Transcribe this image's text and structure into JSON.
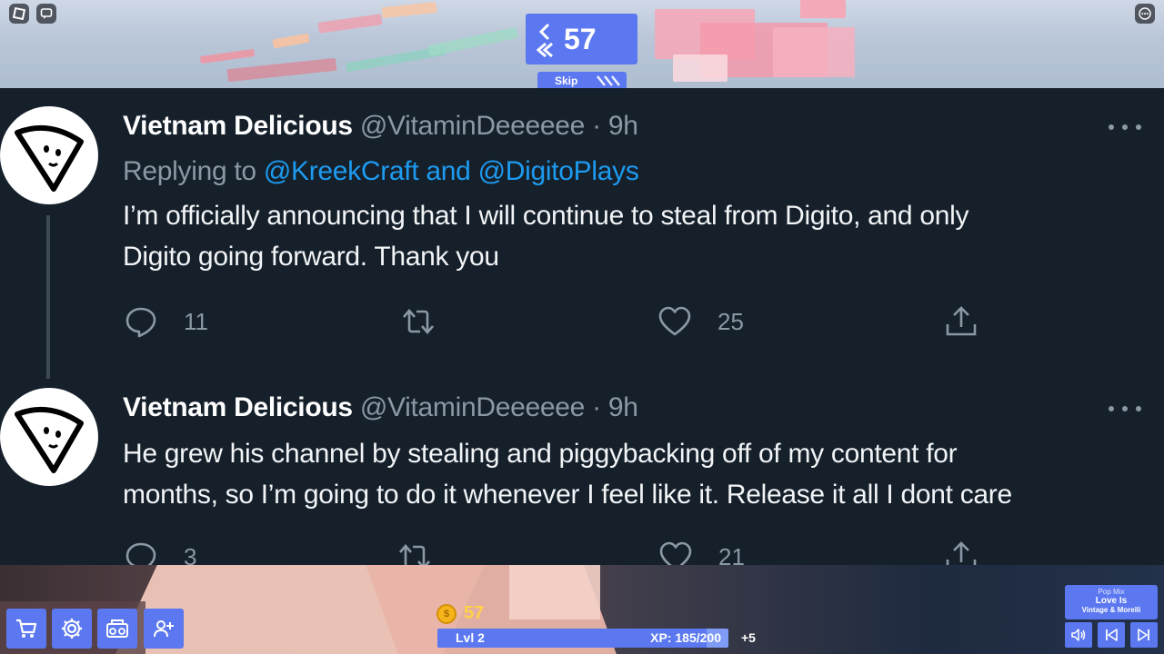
{
  "hud_top": {
    "counter_value": "57",
    "skip_label": "Skip",
    "icons": [
      "roblox-logo-icon",
      "chat-icon",
      "more-options-icon",
      "rewind-icon",
      "skip-forward-icon"
    ]
  },
  "tweets": [
    {
      "name": "Vietnam Delicious",
      "handle": "@VitaminDeeeeee",
      "time": "9h",
      "separator": "·",
      "replying_label": "Replying to",
      "replying_mentions": "@KreekCraft and @DigitoPlays",
      "text_line1": "I’m officially announcing that I will continue to steal from Digito, and only",
      "text_line2": "Digito going forward. Thank you",
      "replies": "11",
      "likes": "25"
    },
    {
      "name": "Vietnam Delicious",
      "handle": "@VitaminDeeeeee",
      "time": "9h",
      "separator": "·",
      "text_line1": "He grew his channel by stealing and piggybacking off of my content for",
      "text_line2": "months, so I’m going to do it whenever I feel like it. Release it all I dont care",
      "replies": "3",
      "likes": "21"
    }
  ],
  "hud_bottom": {
    "buttons": [
      "shop",
      "settings",
      "boombox",
      "invite-friends"
    ],
    "coins": "57",
    "coin_symbol": "$",
    "level_label": "Lvl 2",
    "xp_label": "XP: 185/200",
    "xp_progress": 0.925,
    "xp_gain": "+5",
    "music": {
      "mix": "Pop Mix",
      "song": "Love Is",
      "artist": "Vintage & Morelli"
    }
  },
  "colors": {
    "accent": "#5b78f0",
    "tweet_bg": "#15202b",
    "muted_text": "#8b98a5",
    "link": "#1d9bf0",
    "coin_text": "#ffd24a"
  }
}
